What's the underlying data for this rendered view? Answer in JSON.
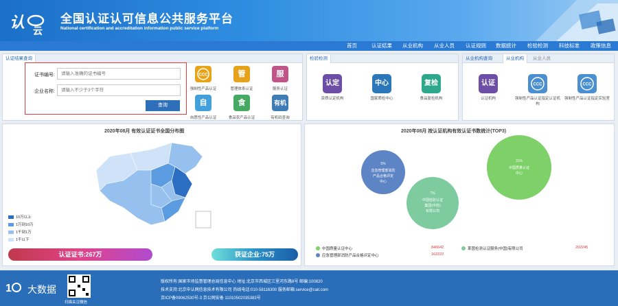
{
  "header": {
    "logo_text": "认",
    "title": "全国认证认可信息公共服务平台",
    "subtitle": "National certification and accreditation information public service platform"
  },
  "nav": {
    "items": [
      "首页",
      "认证结果",
      "从业机构",
      "从业人员",
      "认证规则",
      "数据统计",
      "检验检测",
      "科技标准",
      "政策信息"
    ]
  },
  "cert_query": {
    "tab_label": "认证结果查询",
    "cert_no_label": "证书编号:",
    "cert_no_placeholder": "请输入准确的证书编号",
    "company_label": "企业名称:",
    "company_placeholder": "请输入不少于3个字符",
    "query_button": "查询",
    "tiles": [
      {
        "glyph": "CCC",
        "caption": "强制性产品认证",
        "color": "#e8a318"
      },
      {
        "glyph": "管",
        "caption": "管理体系认证",
        "color": "#e6a21a"
      },
      {
        "glyph": "服",
        "caption": "服务认证",
        "color": "#c05688"
      },
      {
        "glyph": "自",
        "caption": "自愿性产品认证",
        "color": "#42a0dc"
      },
      {
        "glyph": "食",
        "caption": "食品农产品认证",
        "color": "#45a961"
      },
      {
        "glyph": "有机",
        "caption": "有机码查询",
        "color": "#3f7bb5"
      }
    ]
  },
  "inspection": {
    "tab_label": "检验检测",
    "items": [
      {
        "glyph": "认定",
        "caption": "资质认定机构",
        "color": "#6d4ea6"
      },
      {
        "glyph": "中心",
        "caption": "国家质检中心",
        "color": "#2c77b9"
      },
      {
        "glyph": "复检",
        "caption": "食品复检机构",
        "color": "#2ea88a"
      }
    ]
  },
  "org_query": {
    "tabs": [
      "从业机构查询",
      "从业机构",
      "从业人员"
    ],
    "items": [
      {
        "glyph": "认证",
        "caption": "认证机构",
        "color": "#6d4ea6"
      },
      {
        "glyph": "CCC",
        "caption": "强制性产品认证指定认证机构",
        "color": "#4a8fcf"
      },
      {
        "glyph": "CCC",
        "caption": "强制性产品认证指定实验室",
        "color": "#4a8fcf"
      }
    ]
  },
  "map_panel": {
    "title": "2020年08月  有效认证证书全国分布图",
    "legend": [
      {
        "label": "10万以上",
        "color": "#2c6fc2"
      },
      {
        "label": "1万到10万",
        "color": "#5b9be0"
      },
      {
        "label": "1千到1万",
        "color": "#96c0ee"
      },
      {
        "label": "1千以下",
        "color": "#cfe2f8"
      }
    ],
    "cert_bar": "认证证书:267万",
    "company_bar": "获证企业:75万"
  },
  "top3_panel": {
    "title": "2020年08月  按认证机构有效认证书数统计(TOP3)",
    "bubbles": [
      {
        "pct": "5%",
        "name": "应急管理部消防产品合格评定中心",
        "color": "#5d84c4"
      },
      {
        "pct": "7%",
        "name": "中国检验认证集团(中检)有限公司",
        "color": "#7dcb9f"
      },
      {
        "pct": "31%",
        "name": "中国质量认证中心",
        "color": "#7dd168"
      }
    ],
    "legend": [
      {
        "name": "中国质量认证中心",
        "value": "846642",
        "color": "#7dd168"
      },
      {
        "name": "莱茵检测认证服务(中国)有限公司",
        "value": "202245",
        "color": "#7dcb9f"
      },
      {
        "name": "应急管理部消防产品合格评定中心",
        "value": "162222",
        "color": "#5d84c4"
      }
    ]
  },
  "footer": {
    "brand": "大数据",
    "qr_caption": "扫描关注微信",
    "lines": [
      "版权所有:国家市场监督管理总局信息中心   地址:北京市西城区三里河东路8号   邮编:100820",
      "技术支持:北京中认网信息技术有限公司   热线电话:010-58116300   服务邮箱:service@cait.com",
      "京ICP备09062530号-3     京公网安备 11010502035383号"
    ]
  }
}
